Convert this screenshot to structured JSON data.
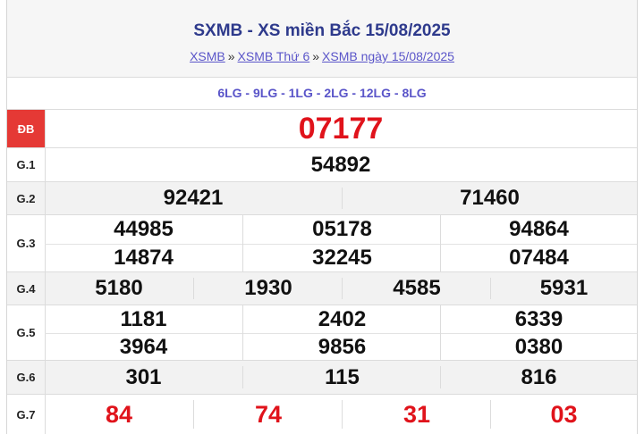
{
  "header": {
    "title": "SXMB - XS miền Bắc 15/08/2025",
    "breadcrumbs": [
      "XSMB",
      "XSMB Thứ 6",
      "XSMB ngày 15/08/2025"
    ],
    "separator": "»"
  },
  "codes": "6LG - 9LG - 1LG - 2LG - 12LG - 8LG",
  "prizes": {
    "db": {
      "label": "ĐB",
      "values": [
        "07177"
      ]
    },
    "g1": {
      "label": "G.1",
      "values": [
        "54892"
      ]
    },
    "g2": {
      "label": "G.2",
      "values": [
        "92421",
        "71460"
      ]
    },
    "g3": {
      "label": "G.3",
      "values": [
        "44985",
        "05178",
        "94864",
        "14874",
        "32245",
        "07484"
      ]
    },
    "g4": {
      "label": "G.4",
      "values": [
        "5180",
        "1930",
        "4585",
        "5931"
      ]
    },
    "g5": {
      "label": "G.5",
      "values": [
        "1181",
        "2402",
        "6339",
        "3964",
        "9856",
        "0380"
      ]
    },
    "g6": {
      "label": "G.6",
      "values": [
        "301",
        "115",
        "816"
      ]
    },
    "g7": {
      "label": "G.7",
      "values": [
        "84",
        "74",
        "31",
        "03"
      ]
    }
  },
  "colors": {
    "accent_red": "#e0131b",
    "label_red_bg": "#e53935",
    "title_blue": "#2e3a8c",
    "link_purple": "#5a55c9"
  }
}
